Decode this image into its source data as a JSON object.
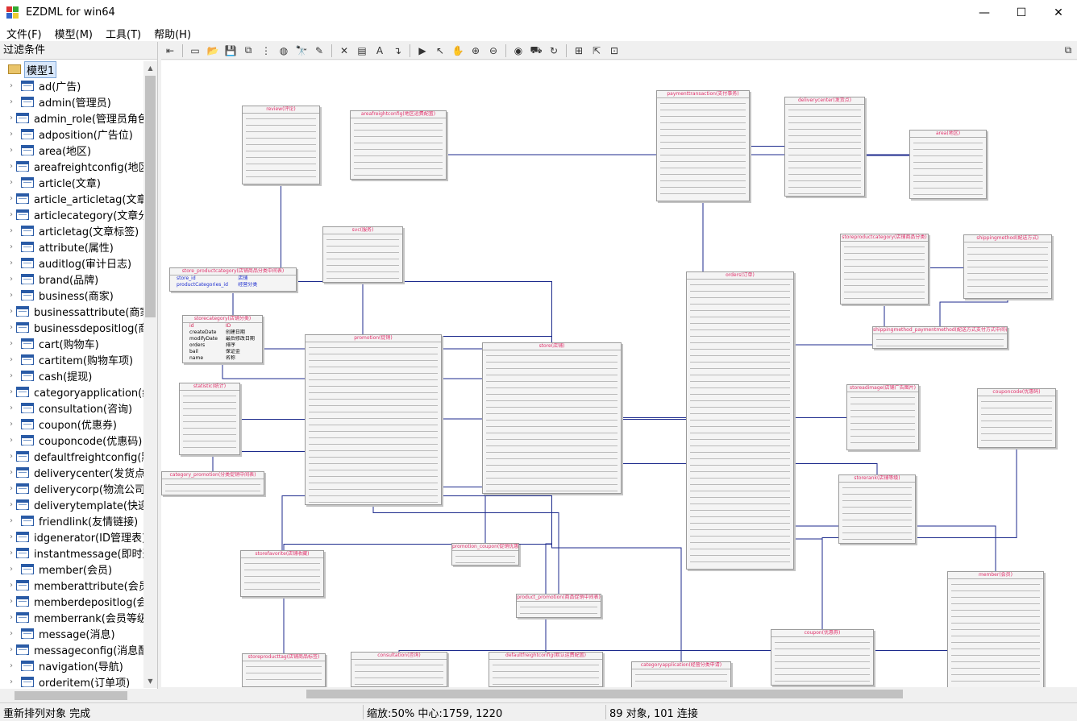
{
  "window": {
    "title": "EZDML for win64",
    "minimize": "—",
    "maximize": "☐",
    "close": "✕"
  },
  "menu": [
    "文件(F)",
    "模型(M)",
    "工具(T)",
    "帮助(H)"
  ],
  "left_panel": {
    "filter_label": "过滤条件",
    "root": "模型1",
    "items": [
      "ad(广告)",
      "admin(管理员)",
      "admin_role(管理员角色",
      "adposition(广告位)",
      "area(地区)",
      "areafreightconfig(地区",
      "article(文章)",
      "article_articletag(文章文",
      "articlecategory(文章分类",
      "articletag(文章标签)",
      "attribute(属性)",
      "auditlog(审计日志)",
      "brand(品牌)",
      "business(商家)",
      "businessattribute(商家属",
      "businessdepositlog(商",
      "cart(购物车)",
      "cartitem(购物车项)",
      "cash(提现)",
      "categoryapplication(经",
      "consultation(咨询)",
      "coupon(优惠券)",
      "couponcode(优惠码)",
      "defaultfreightconfig(默",
      "deliverycenter(发货点)",
      "deliverycorp(物流公司)",
      "deliverytemplate(快递单",
      "friendlink(友情链接)",
      "idgenerator(ID管理表)",
      "instantmessage(即时通",
      "member(会员)",
      "memberattribute(会员注",
      "memberdepositlog(会",
      "memberrank(会员等级)",
      "message(消息)",
      "messageconfig(消息配",
      "navigation(导航)",
      "orderitem(订单项)"
    ]
  },
  "toolbar_icons": [
    "back-icon",
    "new-icon",
    "open-icon",
    "save-icon",
    "copy-icon",
    "tree-icon",
    "globe-icon",
    "find-icon",
    "pencil-icon",
    "delete-icon",
    "table-icon",
    "text-icon",
    "link-icon",
    "run-icon",
    "pointer-icon",
    "hand-icon",
    "zoom-in-icon",
    "zoom-out-icon",
    "eye-icon",
    "car-icon",
    "refresh-icon",
    "layout-icon",
    "export-icon",
    "fit-icon",
    "panel-icon"
  ],
  "canvas": {
    "cards": [
      {
        "title": "store_productcategory(店铺商品分类中间表)",
        "rows": [
          [
            "store_id",
            "店铺"
          ],
          [
            "productCategories_id",
            "经营分类"
          ]
        ]
      },
      {
        "title": "storecategory(店铺分类)",
        "rows": [
          [
            "id",
            "ID"
          ],
          [
            "createDate",
            "创建日期"
          ],
          [
            "modifyDate",
            "最后修改日期"
          ],
          [
            "orders",
            "排序"
          ],
          [
            "bail",
            "保证金"
          ],
          [
            "name",
            "名称"
          ]
        ]
      },
      {
        "title": "orders(订单)"
      },
      {
        "title": "store(店铺)"
      },
      {
        "title": "promotion(促销)"
      },
      {
        "title": "statistic(统计)"
      },
      {
        "title": "review(评论)"
      },
      {
        "title": "areafreightconfig(地区运费配置)"
      },
      {
        "title": "svc(服务)"
      },
      {
        "title": "paymenttransaction(支付事务)"
      },
      {
        "title": "deliverycenter(发货点)"
      },
      {
        "title": "area(地区)"
      },
      {
        "title": "storeproductcategory(店铺商品分类)"
      },
      {
        "title": "shippingmethod(配送方式)"
      },
      {
        "title": "shippingmethod_paymentmethod(配送方式支付方式中间表)"
      },
      {
        "title": "storeadimage(店铺广告图片)"
      },
      {
        "title": "couponcode(优惠码)"
      },
      {
        "title": "storerank(店铺等级)"
      },
      {
        "title": "member(会员)"
      },
      {
        "title": "coupon(优惠券)"
      },
      {
        "title": "categoryapplication(经营分类申请)"
      },
      {
        "title": "defaultfreightconfig(默认运费配置)"
      },
      {
        "title": "consultation(咨询)"
      },
      {
        "title": "storeproducttag(店铺商品标签)"
      },
      {
        "title": "storefavorite(店铺收藏)"
      },
      {
        "title": "promotion_coupon(促销优惠券中间表)"
      },
      {
        "title": "product_promotion(商品促销中间表)"
      },
      {
        "title": "category_promotion(分类促销中间表)"
      }
    ]
  },
  "status": {
    "left": "重新排列对象 完成",
    "zoom": "缩放:50% 中心:1759, 1220",
    "count": "89 对象, 101 连接"
  }
}
